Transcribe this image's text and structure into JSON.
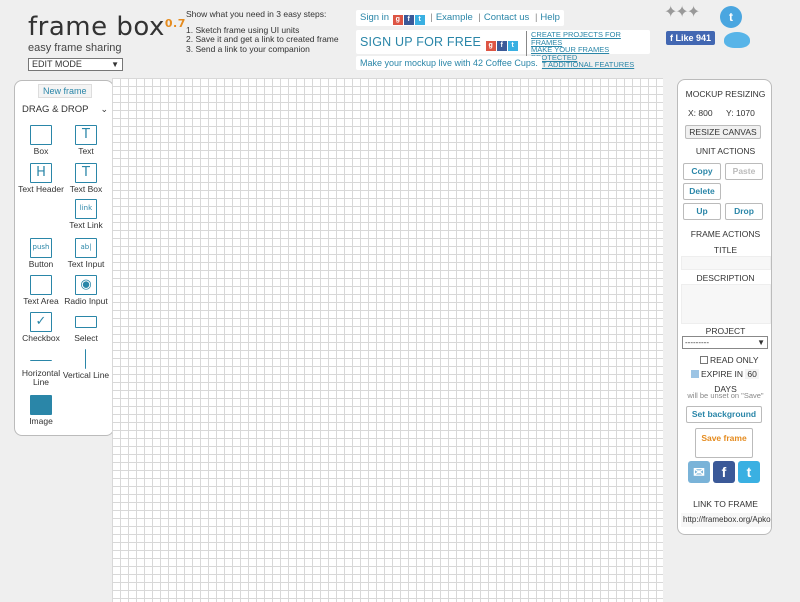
{
  "header": {
    "logo": "frame box",
    "version": "0.7",
    "tagline": "easy frame sharing",
    "mode": "EDIT MODE",
    "steps_title": "Show what you need in 3 easy steps:",
    "steps": [
      "1. Sketch frame using UI units",
      "2. Save it and get a link to created frame",
      "3. Send a link to your companion"
    ],
    "signin": "Sign in",
    "links": [
      "Example",
      "Contact us",
      "Help"
    ],
    "signup": "SIGN UP FOR FREE",
    "signup_notes": [
      "CREATE PROJECTS FOR FRAMES",
      "MAKE YOUR FRAMES PROTECTED",
      "GET ADDITIONAL FEATURES"
    ],
    "coffee": "Make your mockup live with 42 Coffee Cups.",
    "like": "Like 941"
  },
  "left_panel": {
    "new_frame": "New frame",
    "section": "DRAG & DROP",
    "tools": [
      {
        "label": "Box",
        "icon": "box-icon",
        "glyph": ""
      },
      {
        "label": "Text",
        "icon": "text-icon",
        "glyph": "T"
      },
      {
        "label": "Text Header",
        "icon": "text-header-icon",
        "glyph": "H"
      },
      {
        "label": "Text Box",
        "icon": "text-box-icon",
        "glyph": "T"
      },
      {
        "label": "Text Link",
        "icon": "text-link-icon",
        "glyph": "link"
      },
      {
        "label": "Button",
        "icon": "button-icon",
        "glyph": "push"
      },
      {
        "label": "Text Input",
        "icon": "text-input-icon",
        "glyph": "ab|"
      },
      {
        "label": "Text Area",
        "icon": "text-area-icon",
        "glyph": ""
      },
      {
        "label": "Radio Input",
        "icon": "radio-input-icon",
        "glyph": "◉"
      },
      {
        "label": "Checkbox",
        "icon": "checkbox-icon",
        "glyph": "✓"
      },
      {
        "label": "Select",
        "icon": "select-icon",
        "glyph": ""
      },
      {
        "label": "Horizontal Line",
        "icon": "horizontal-line-icon",
        "glyph": ""
      },
      {
        "label": "Vertical Line",
        "icon": "vertical-line-icon",
        "glyph": ""
      },
      {
        "label": "Image",
        "icon": "image-icon",
        "glyph": ""
      }
    ]
  },
  "right_panel": {
    "mockup_resizing": "MOCKUP RESIZING",
    "x_label": "X:",
    "x_value": "800",
    "y_label": "Y:",
    "y_value": "1070",
    "resize": "RESIZE CANVAS",
    "unit_actions": "UNIT ACTIONS",
    "copy": "Copy",
    "paste": "Paste",
    "delete": "Delete",
    "up": "Up",
    "drop": "Drop",
    "frame_actions": "FRAME ACTIONS",
    "title": "TITLE",
    "description": "DESCRIPTION",
    "project": "PROJECT",
    "project_value": "---------",
    "read_only": "READ ONLY",
    "expire_in": "EXPIRE IN",
    "expire_days": "60",
    "days": "DAYS",
    "unset_note": "will be unset on \"Save\"",
    "set_background": "Set background",
    "save_frame": "Save frame",
    "link_to_frame": "LINK TO FRAME",
    "link_value": "http://framebox.org/Apko"
  },
  "colors": {
    "accent": "#2a86a8",
    "version": "#e58b1e",
    "facebook": "#3b5998",
    "twitter": "#3ab0e2"
  }
}
